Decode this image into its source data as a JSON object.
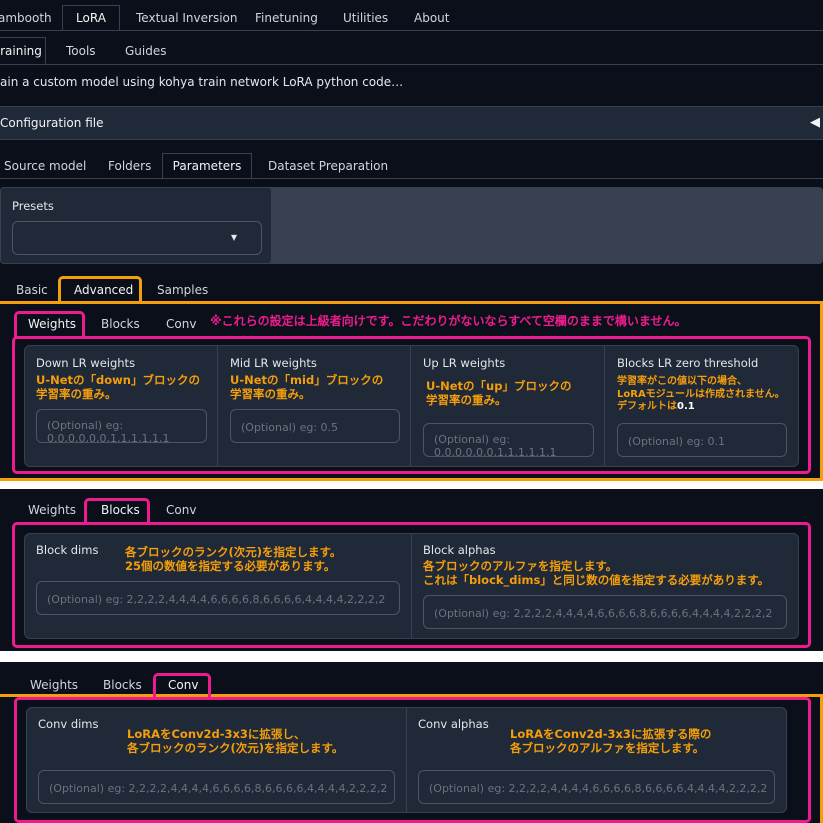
{
  "top_tabs": [
    "ambooth",
    "LoRA",
    "Textual Inversion",
    "Finetuning",
    "Utilities",
    "About"
  ],
  "sub_tabs": [
    "raining",
    "Tools",
    "Guides"
  ],
  "description": "ain a custom model using kohya train network LoRA python code…",
  "config": {
    "label": "Configuration file",
    "toggle": "◀"
  },
  "section_tabs": [
    "Source model",
    "Folders",
    "Parameters",
    "Dataset Preparation"
  ],
  "presets": {
    "label": "Presets",
    "dropdown_icon": "▾"
  },
  "param_tabs": [
    "Basic",
    "Advanced",
    "Samples"
  ],
  "adv_tabs": [
    "Weights",
    "Blocks",
    "Conv"
  ],
  "adv_note": "※これらの設定は上級者向けです。こだわりがないならすべて空欄のままで構いません。",
  "weights": {
    "down": {
      "label": "Down LR weights",
      "note1": "U-Netの「down」ブロックの",
      "note2": "学習率の重み。",
      "placeholder1": "(Optional) eg:",
      "placeholder2": "0,0,0,0,0,0,1,1,1,1,1,1"
    },
    "mid": {
      "label": "Mid LR weights",
      "note1": "U-Netの「mid」ブロックの",
      "note2": "学習率の重み。",
      "placeholder": "(Optional) eg: 0.5"
    },
    "up": {
      "label": "Up LR weights",
      "note1": "U-Netの「up」ブロックの",
      "note2": "学習率の重み。",
      "placeholder1": "(Optional) eg:",
      "placeholder2": "0,0,0,0,0,0,1,1,1,1,1,1"
    },
    "zero": {
      "label": "Blocks LR zero threshold",
      "note1": "学習率がこの値以下の場合、",
      "note2": "LoRAモジュールは作成されません。",
      "note3a": "デフォルトは",
      "note3b": "0.1",
      "placeholder": "(Optional) eg: 0.1"
    }
  },
  "blocks": {
    "dims": {
      "label": "Block dims",
      "note1": "各ブロックのランク(次元)を指定します。",
      "note2": "25個の数値を指定する必要があります。",
      "placeholder": "(Optional) eg: 2,2,2,2,4,4,4,4,6,6,6,6,8,6,6,6,6,4,4,4,4,2,2,2,2"
    },
    "alphas": {
      "label": "Block alphas",
      "note1": "各ブロックのアルファを指定します。",
      "note2": "これは「block_dims」と同じ数の値を指定する必要があります。",
      "placeholder": "(Optional) eg: 2,2,2,2,4,4,4,4,6,6,6,6,8,6,6,6,6,4,4,4,4,2,2,2,2"
    }
  },
  "conv": {
    "dims": {
      "label": "Conv dims",
      "note1": "LoRAをConv2d-3x3に拡張し、",
      "note2": "各ブロックのランク(次元)を指定します。",
      "placeholder": "(Optional) eg: 2,2,2,2,4,4,4,4,6,6,6,6,8,6,6,6,6,4,4,4,4,2,2,2,2"
    },
    "alphas": {
      "label": "Conv alphas",
      "note1": "LoRAをConv2d-3x3に拡張する際の",
      "note2": "各ブロックのアルファを指定します。",
      "placeholder": "(Optional) eg: 2,2,2,2,4,4,4,4,6,6,6,6,8,6,6,6,6,4,4,4,4,2,2,2,2"
    }
  },
  "colors": {
    "background": "#0b0f19",
    "panel": "#1f2937",
    "highlight_pink": "#ec1c8e",
    "highlight_orange": "#f59e0b",
    "note_text": "#f59e0b"
  }
}
